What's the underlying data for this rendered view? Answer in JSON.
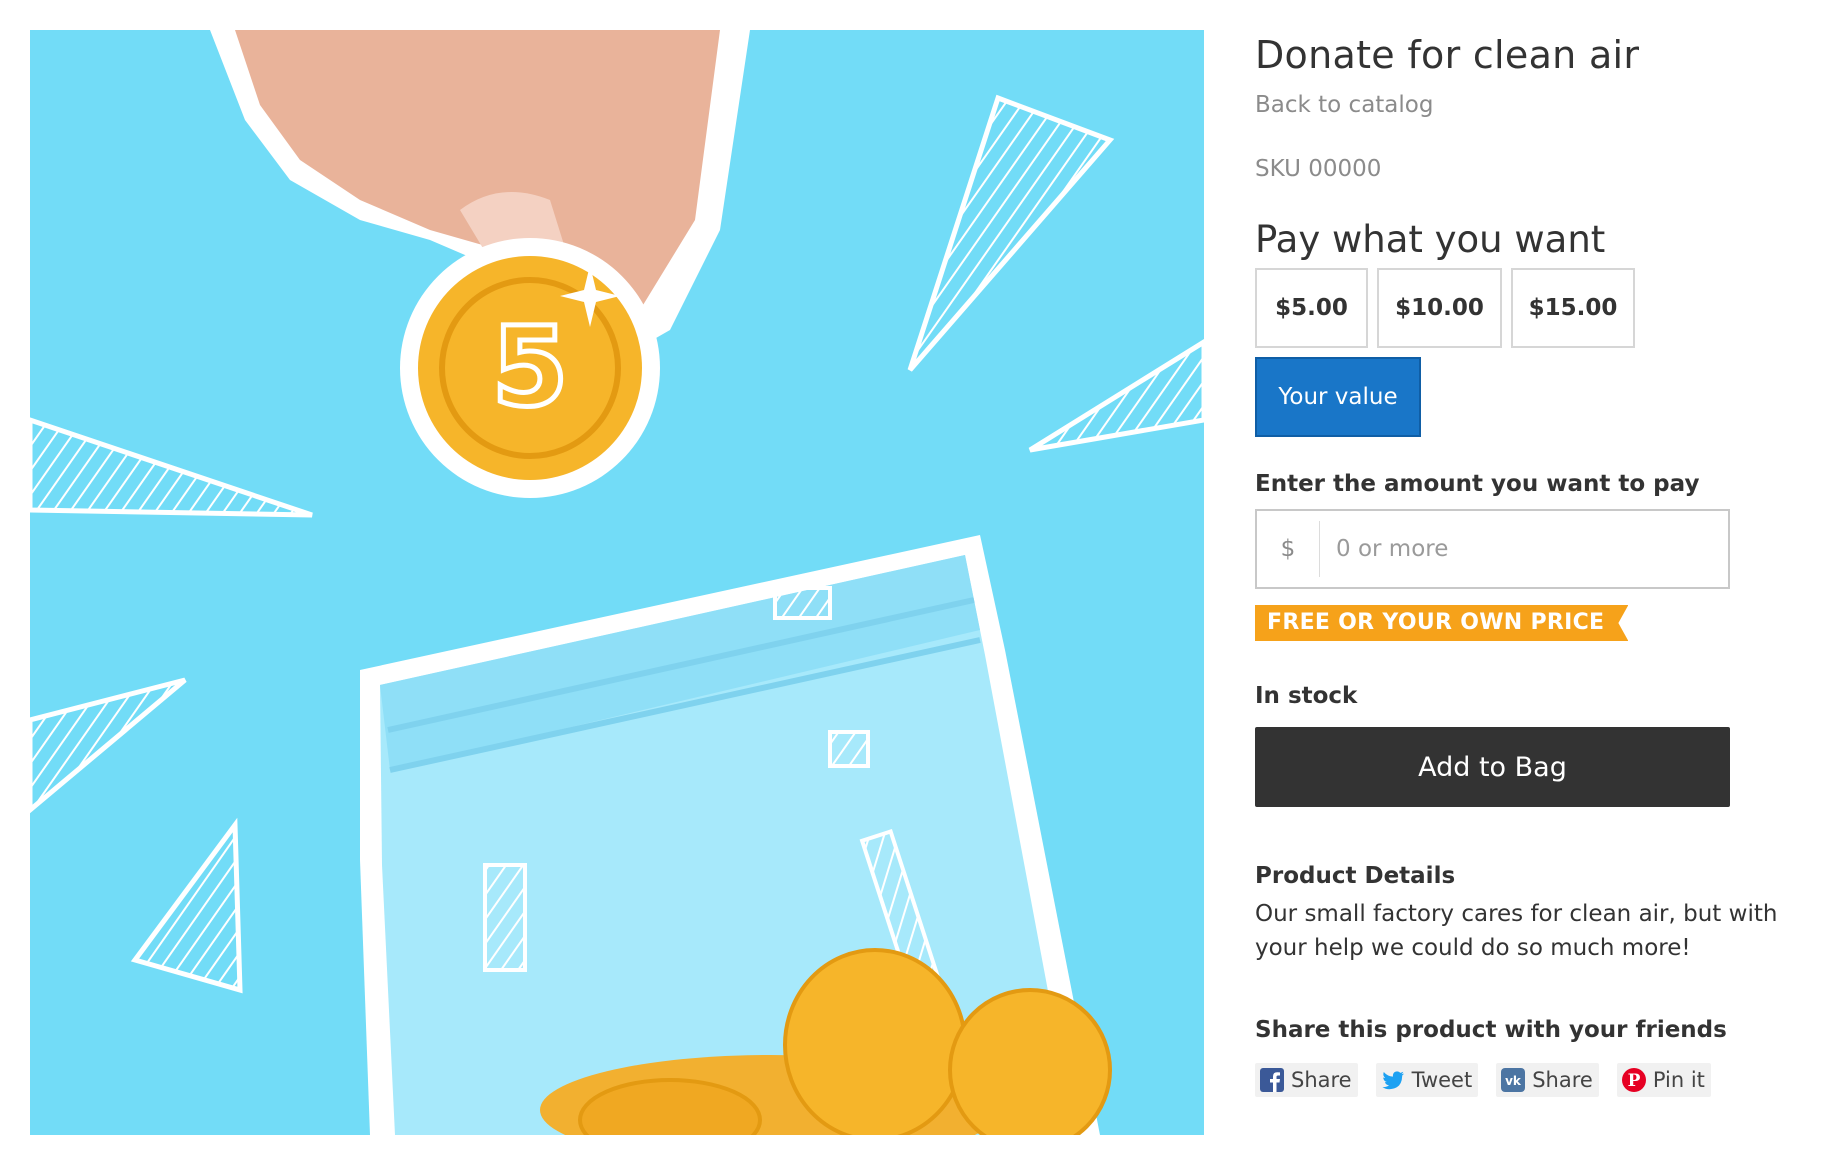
{
  "product": {
    "title": "Donate for clean air",
    "back_link": "Back to catalog",
    "sku": "SKU 00000"
  },
  "pricing": {
    "heading": "Pay what you want",
    "options": [
      "$5.00",
      "$10.00",
      "$15.00"
    ],
    "custom_label": "Your value",
    "amount_label": "Enter the amount you want to pay",
    "currency_symbol": "$",
    "amount_placeholder": "0 or more",
    "amount_value": "",
    "ribbon": "FREE OR YOUR OWN PRICE",
    "accent_color": "#1976c8",
    "ribbon_color": "#f6a21a"
  },
  "stock": {
    "status": "In stock"
  },
  "cart": {
    "add_label": "Add to Bag"
  },
  "details": {
    "heading": "Product Details",
    "text": "Our small factory cares for clean air, but with your help we could do so much more!"
  },
  "share": {
    "heading": "Share this product with your friends",
    "buttons": [
      {
        "icon": "facebook-icon",
        "label": "Share"
      },
      {
        "icon": "twitter-icon",
        "label": "Tweet"
      },
      {
        "icon": "vk-icon",
        "label": "Share"
      },
      {
        "icon": "pinterest-icon",
        "label": "Pin it"
      }
    ]
  },
  "image": {
    "coin_label": "5",
    "background_color": "#72dcf7"
  }
}
